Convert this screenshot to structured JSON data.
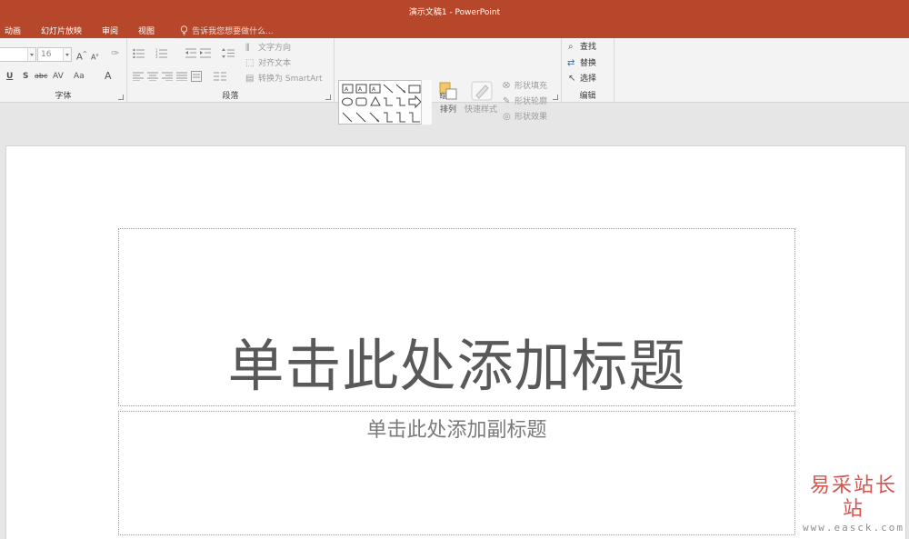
{
  "window": {
    "title": "演示文稿1 - PowerPoint"
  },
  "tabs": [
    "动画",
    "幻灯片放映",
    "审阅",
    "视图"
  ],
  "tell_me": "告诉我您想要做什么...",
  "ribbon": {
    "font": {
      "label": "字体",
      "size_value": "16",
      "buttons": {
        "underline": "U",
        "shadow": "S",
        "strike": "abc",
        "spacing": "AV",
        "case": "Aa",
        "color": "A"
      }
    },
    "paragraph": {
      "label": "段落",
      "text_direction": "文字方向",
      "align_text": "对齐文本",
      "convert_smartart": "转换为 SmartArt"
    },
    "drawing": {
      "label": "绘图",
      "arrange": "排列",
      "quick_styles": "快速样式",
      "shape_fill": "形状填充",
      "shape_outline": "形状轮廓",
      "shape_effects": "形状效果"
    },
    "editing": {
      "label": "编辑",
      "find": "查找",
      "replace": "替换",
      "select": "选择"
    }
  },
  "slide": {
    "title_placeholder": "单击此处添加标题",
    "subtitle_placeholder": "单击此处添加副标题"
  },
  "watermark": {
    "name": "易采站长站",
    "url": "www.easck.com"
  },
  "colors": {
    "accent": "#b7472a"
  }
}
